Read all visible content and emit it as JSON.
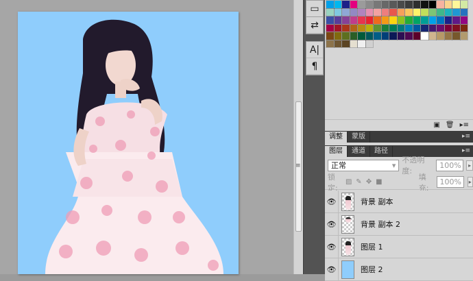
{
  "swatch_colors": [
    "#00a0e9",
    "#00b7ee",
    "#1d2088",
    "#e4007f",
    "#9b9b9b",
    "#8a8a8a",
    "#787878",
    "#686868",
    "#595959",
    "#4a4a4a",
    "#3c3c3c",
    "#2e2e2e",
    "#111111",
    "#000000",
    "#f7b2a0",
    "#fbd38d",
    "#fff79a",
    "#d3e9a4",
    "#9ad3c0",
    "#80c8e0",
    "#8fa8d6",
    "#9389c3",
    "#b183bd",
    "#e58fb0",
    "#f2a2a2",
    "#ee7e7e",
    "#e8574c",
    "#f5a05b",
    "#f9c75f",
    "#fef36a",
    "#c2df5b",
    "#7cc576",
    "#3fb88a",
    "#1db2bd",
    "#1f97d3",
    "#2672bf",
    "#3a4fa5",
    "#5a3c99",
    "#874196",
    "#c03d8c",
    "#e6354f",
    "#e7242e",
    "#ed6a1d",
    "#f39a16",
    "#fbd511",
    "#8dc21f",
    "#23ac38",
    "#00a466",
    "#009e96",
    "#00a0e9",
    "#0075c2",
    "#1d2088",
    "#601986",
    "#920783",
    "#a40046",
    "#a31526",
    "#a9361a",
    "#b06418",
    "#b78c11",
    "#b8b10b",
    "#5d9432",
    "#1a7e3a",
    "#007b57",
    "#00787c",
    "#007db5",
    "#00589f",
    "#152673",
    "#44176f",
    "#6a0e6c",
    "#7c0038",
    "#7f1020",
    "#7a2a10",
    "#7a4714",
    "#816a0e",
    "#5d6f1f",
    "#2a5e26",
    "#005a3a",
    "#00585c",
    "#005d86",
    "#003f78",
    "#0c1a57",
    "#2d0f53",
    "#4d0a51",
    "#5c002a",
    "#ffffff",
    "#cfb48e",
    "#b79968",
    "#957546",
    "#77582c",
    "#b29b6f",
    "#8c734b",
    "#6e5632",
    "#5b4423",
    "#e5dfd0",
    "#f0f0f0",
    "#d0d0d0"
  ],
  "swatch_footer": {
    "new_icon": "new-swatch-icon",
    "trash_icon": "trash-icon",
    "new_glyph": "▣",
    "trash_glyph": "🗑",
    "collapse_glyph": "▸≡"
  },
  "adjust_panel": {
    "tabs": [
      "调整",
      "蒙版"
    ],
    "active": 0
  },
  "layers_panel": {
    "tabs": [
      "图层",
      "通道",
      "路径"
    ],
    "active": 0,
    "blend_mode": "正常",
    "opacity_label": "不透明度:",
    "opacity_value": "100%",
    "lock_label": "锁定:",
    "fill_label": "填充:",
    "fill_value": "100%",
    "layers": [
      {
        "name": "背景 副本",
        "thumb": "figure"
      },
      {
        "name": "背景 副本 2",
        "thumb": "figure"
      },
      {
        "name": "图层 1",
        "thumb": "figure"
      },
      {
        "name": "图层 2",
        "thumb": "solid"
      }
    ]
  },
  "toolstrip_icons": [
    "history-icon",
    "character-swap-icon",
    "character-icon",
    "paragraph-icon"
  ],
  "toolstrip_glyphs": [
    "▭",
    "⇄",
    "A|",
    "¶"
  ],
  "document_bg": "#8fcdfc"
}
